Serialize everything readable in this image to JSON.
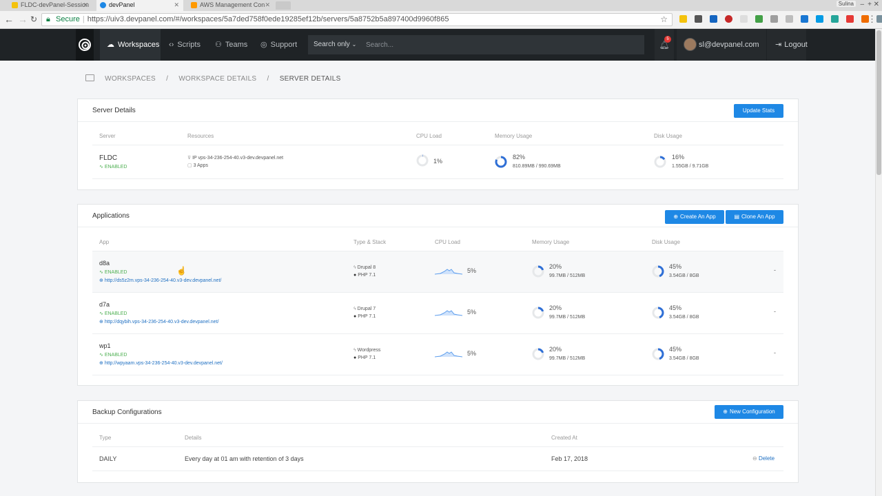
{
  "browser": {
    "tabs": [
      {
        "title": "FLDC-devPanel-Session",
        "color": "#f4c20d"
      },
      {
        "title": "devPanel",
        "color": "#1e88e5"
      },
      {
        "title": "AWS Management Con",
        "color": "#ff9900"
      }
    ],
    "user_chip": "Sulina",
    "secure_label": "Secure",
    "url": "https://uiv3.devpanel.com/#/workspaces/5a7ded758f0ede19285ef12b/servers/5a8752b5a897400d9960f865"
  },
  "nav": {
    "logo_icon": "swirl-logo-icon",
    "items": [
      {
        "label": "Workspaces",
        "icon": "cloud-icon"
      },
      {
        "label": "Scripts",
        "icon": "code-icon"
      },
      {
        "label": "Teams",
        "icon": "users-icon"
      },
      {
        "label": "Support",
        "icon": "lifebuoy-icon"
      }
    ],
    "search_scope": "Search only",
    "search_placeholder": "Search...",
    "notification_count": "5",
    "user_email": "sl@devpanel.com",
    "logout_label": "Logout"
  },
  "breadcrumb": {
    "items": [
      "WORKSPACES",
      "WORKSPACE DETAILS",
      "SERVER DETAILS"
    ],
    "separator": "/"
  },
  "server_details": {
    "title": "Server Details",
    "update_button": "Update Stats",
    "columns": [
      "Server",
      "Resources",
      "CPU Load",
      "Memory Usage",
      "Disk Usage"
    ],
    "server": {
      "name": "FLDC",
      "status": "ENABLED",
      "ip": "IP vps-34-236-254-40.v3-dev.devpanel.net",
      "apps": "3 Apps",
      "cpu": "1%",
      "cpu_fraction": 0.01,
      "memory": "82%",
      "memory_detail": "810.89MB / 990.69MB",
      "memory_fraction": 0.82,
      "disk": "16%",
      "disk_detail": "1.55GB / 9.71GB",
      "disk_fraction": 0.16
    }
  },
  "applications": {
    "title": "Applications",
    "create_button": "Create An App",
    "clone_button": "Clone An App",
    "columns": [
      "App",
      "Type & Stack",
      "CPU Load",
      "Memory Usage",
      "Disk Usage"
    ],
    "rows": [
      {
        "name": "d8a",
        "status": "ENABLED",
        "url": "http://ds5z2m.vps-34-236-254-40.v3-dev.devpanel.net/",
        "type": "Drupal 8",
        "stack": "PHP 7.1",
        "cpu": "5%",
        "memory": "20%",
        "memory_detail": "99.7MB / 512MB",
        "memory_fraction": 0.2,
        "disk": "45%",
        "disk_detail": "3.54GB / 8GB",
        "disk_fraction": 0.45,
        "action": "-"
      },
      {
        "name": "d7a",
        "status": "ENABLED",
        "url": "http://dqybih.vps-34-236-254-40.v3-dev.devpanel.net/",
        "type": "Drupal 7",
        "stack": "PHP 7.1",
        "cpu": "5%",
        "memory": "20%",
        "memory_detail": "99.7MB / 512MB",
        "memory_fraction": 0.2,
        "disk": "45%",
        "disk_detail": "3.54GB / 8GB",
        "disk_fraction": 0.45,
        "action": "-"
      },
      {
        "name": "wp1",
        "status": "ENABLED",
        "url": "http://wpyaam.vps-34-236-254-40.v3-dev.devpanel.net/",
        "type": "Wordpress",
        "stack": "PHP 7.1",
        "cpu": "5%",
        "memory": "20%",
        "memory_detail": "99.7MB / 512MB",
        "memory_fraction": 0.2,
        "disk": "45%",
        "disk_detail": "3.54GB / 8GB",
        "disk_fraction": 0.45,
        "action": "-"
      }
    ]
  },
  "backups": {
    "title": "Backup Configurations",
    "new_button": "New Configuration",
    "columns": [
      "Type",
      "Details",
      "Created At"
    ],
    "rows": [
      {
        "type": "DAILY",
        "details": "Every day at 01 am with retention of 3 days",
        "created": "Feb 17, 2018",
        "action": "Delete"
      }
    ]
  },
  "colors": {
    "accent": "#1e88e5",
    "navbar": "#1f2326",
    "enabled": "#4caf50",
    "ring_fill": "#2f6fd6",
    "ring_track": "#e6e8ea"
  }
}
